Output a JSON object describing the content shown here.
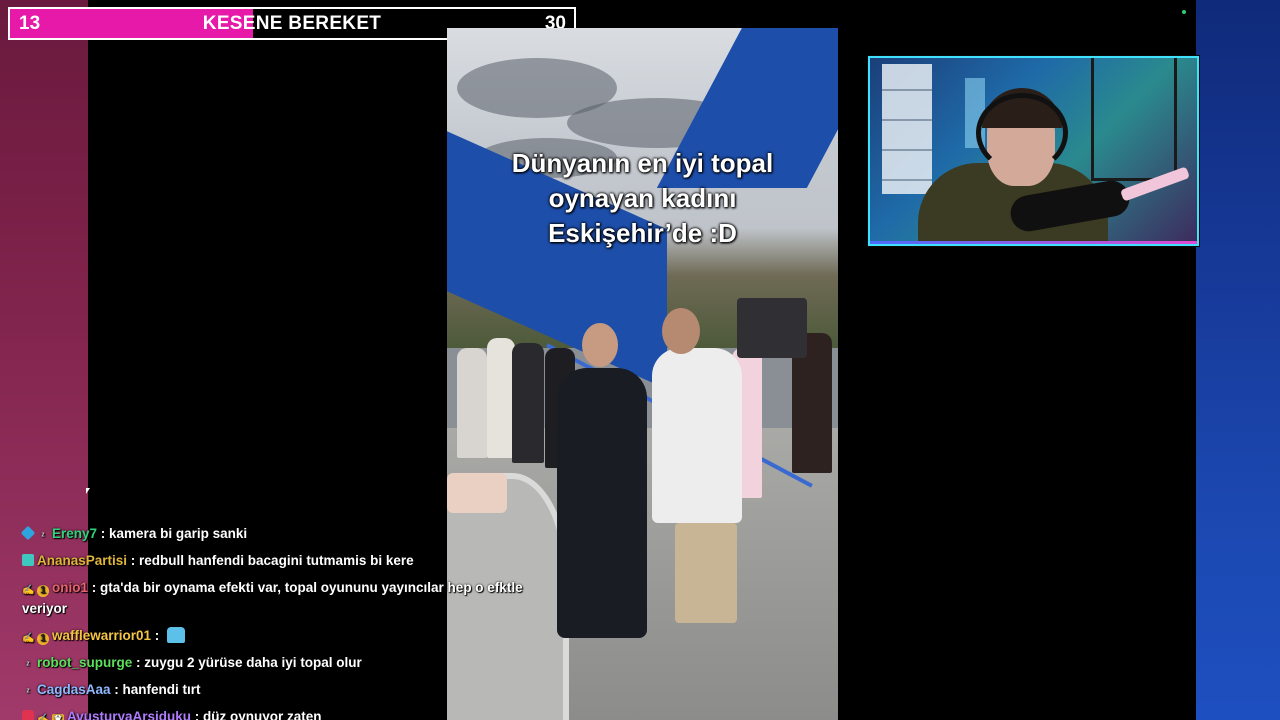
{
  "goal": {
    "current": "13",
    "target": "30",
    "title": "KESENE BEREKET",
    "progress_fraction": 0.43,
    "fill_color": "#e619a8"
  },
  "video": {
    "caption": "Dünyanın en iyi topal\noynayan kadını\nEskişehir’de :D"
  },
  "webcam": {
    "border_color": "#40e0ff"
  },
  "chat": {
    "messages": [
      {
        "badges": [
          "cube-badge",
          "zzz-badge"
        ],
        "user": "Ereny7",
        "color": "#2ed47a",
        "text": "kamera bi garip sanki"
      },
      {
        "badges": [
          "grid-badge"
        ],
        "user": "AnanasPartisi",
        "color": "#e0b53a",
        "text": "redbull hanfendi bacagini tutmamis bi kere"
      },
      {
        "badges": [
          "hand-badge",
          "sub-badge"
        ],
        "user": "onio1",
        "color": "#e8636d",
        "text": "gta'da bir oynama efekti var, topal oyununu yayıncılar hep o efktle veriyor"
      },
      {
        "badges": [
          "hand-badge",
          "sub-badge"
        ],
        "user": "wafflewarrior01",
        "color": "#f5c542",
        "text": "",
        "emote": "emote-icon"
      },
      {
        "badges": [
          "zzz-badge"
        ],
        "user": "robot_supurge",
        "color": "#5be05b",
        "text": "zuygu 2 yürüse daha iyi topal olur"
      },
      {
        "badges": [
          "zzz-badge"
        ],
        "user": "CagdasAaa",
        "color": "#8fb8ff",
        "text": "hanfendi tırt"
      },
      {
        "badges": [
          "gem-badge",
          "hand-badge",
          "crown-badge"
        ],
        "user": "AvusturyaArsiduku",
        "color": "#b07cff",
        "text": "düz oynuyor zaten"
      }
    ]
  }
}
